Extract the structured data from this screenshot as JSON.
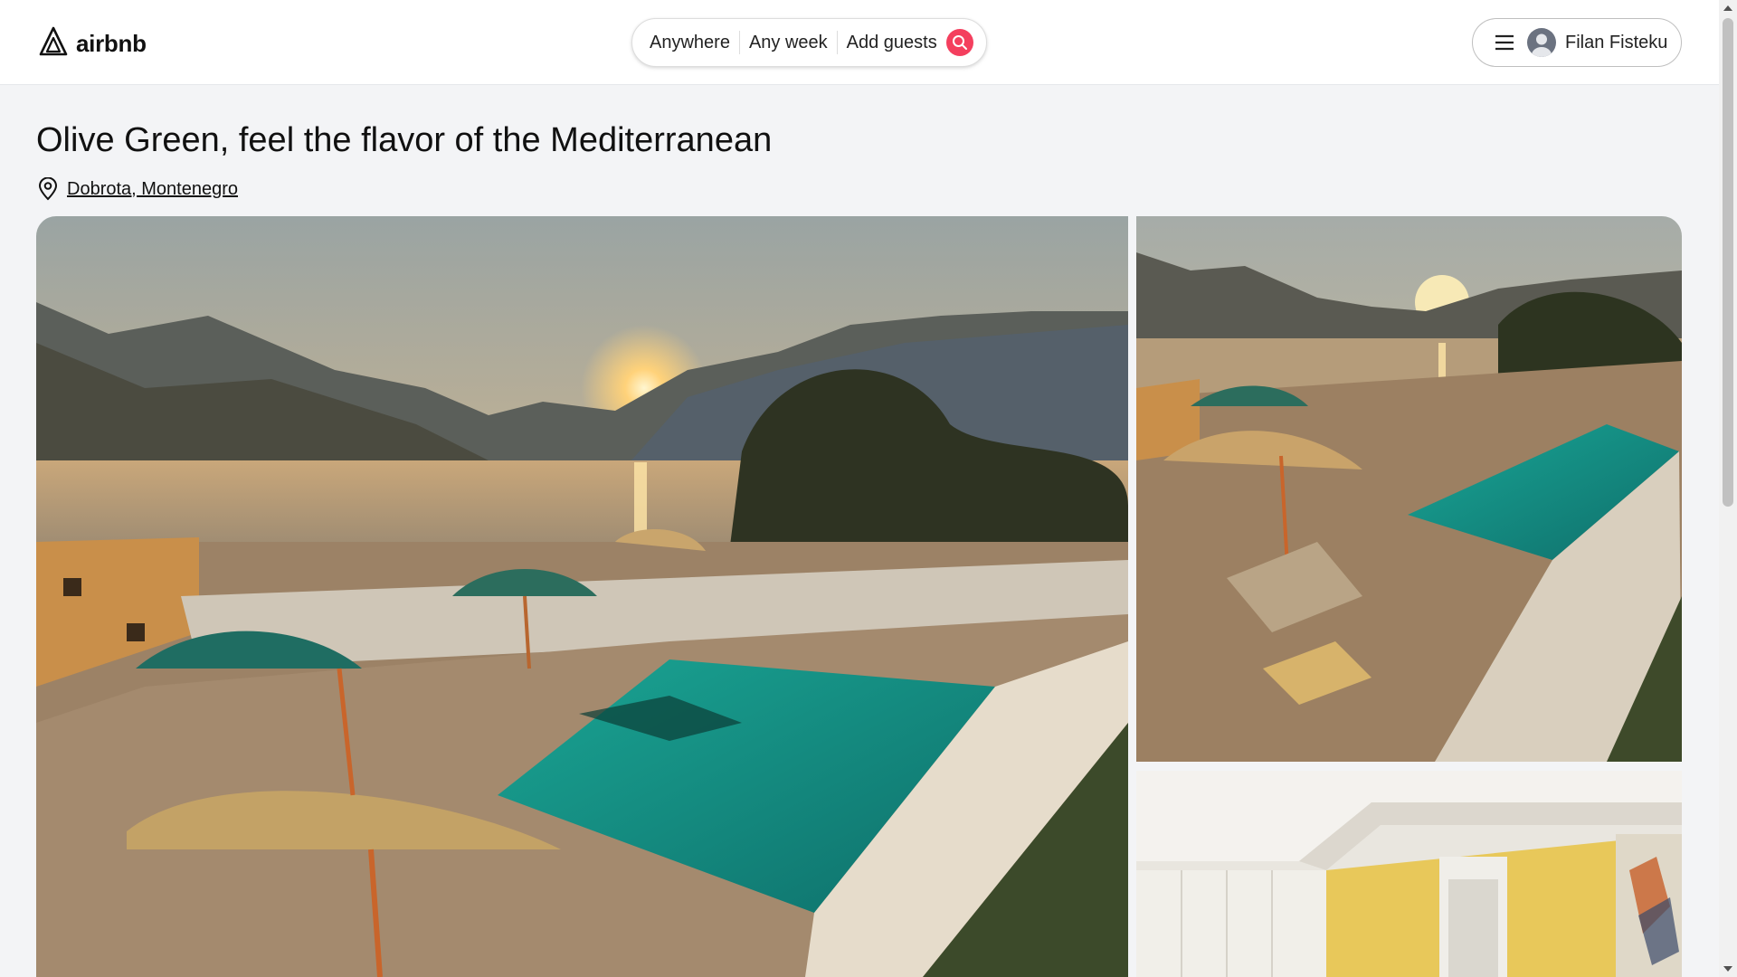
{
  "header": {
    "brand": "airbnb",
    "search": {
      "anywhere": "Anywhere",
      "any_week": "Any week",
      "add_guests": "Add guests"
    },
    "user": {
      "name": "Filan Fisteku"
    }
  },
  "listing": {
    "title": "Olive Green, feel the flavor of the Mediterranean",
    "location": "Dobrota, Montenegro"
  },
  "colors": {
    "accent": "#f43f5e",
    "page_bg": "#f3f4f6"
  },
  "icons": [
    "airbnb-logo-icon",
    "search-icon",
    "hamburger-menu-icon",
    "user-avatar-icon",
    "location-pin-icon"
  ]
}
